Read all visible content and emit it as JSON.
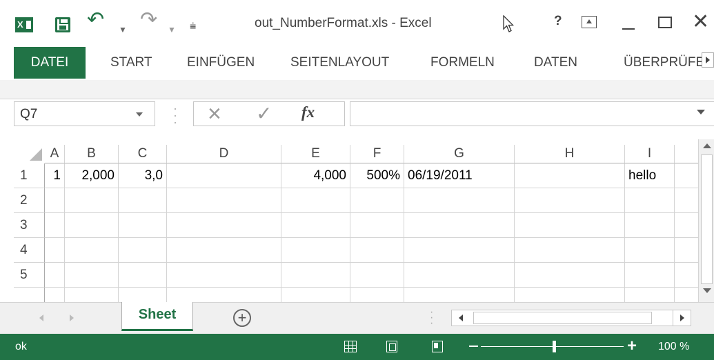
{
  "window": {
    "title": "out_NumberFormat.xls - Excel",
    "app_icon_label": "X"
  },
  "ribbon": {
    "tabs": [
      "DATEI",
      "START",
      "EINFÜGEN",
      "SEITENLAYOUT",
      "FORMELN",
      "DATEN",
      "ÜBERPRÜFE"
    ],
    "active_tab": "DATEI"
  },
  "formula_bar": {
    "name_box": "Q7",
    "fx_label": "fx",
    "formula": ""
  },
  "grid": {
    "columns": [
      "A",
      "B",
      "C",
      "D",
      "E",
      "F",
      "G",
      "H",
      "I"
    ],
    "rows": [
      "1",
      "2",
      "3",
      "4",
      "5"
    ],
    "cells": {
      "A1": "1",
      "B1": "2,000",
      "C1": "3,0",
      "E1": "4,000",
      "F1": "500%",
      "G1": "06/19/2011",
      "I1": "hello"
    }
  },
  "sheets": {
    "tabs": [
      "Sheet"
    ],
    "active": "Sheet",
    "add_label": "+"
  },
  "status_bar": {
    "text": "ok",
    "zoom_level": "100 %",
    "zoom_percent": 100
  },
  "colors": {
    "accent": "#217346",
    "gridline": "#d4d4d4"
  },
  "icons": [
    "excel-icon",
    "save-icon",
    "undo-icon",
    "redo-icon",
    "help-icon",
    "ribbon-display-icon",
    "minimize-icon",
    "maximize-icon",
    "close-icon",
    "cancel-icon",
    "enter-icon",
    "fx-icon",
    "add-sheet-icon",
    "normal-view-icon",
    "page-layout-icon",
    "page-break-icon"
  ]
}
